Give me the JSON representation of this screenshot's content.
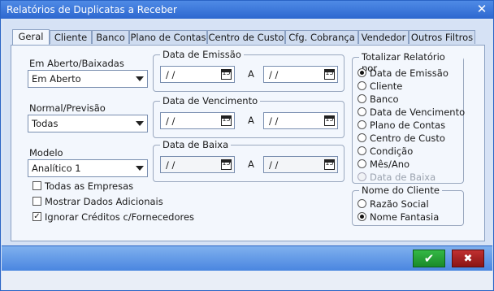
{
  "window": {
    "title": "Relatórios de Duplicatas a Receber",
    "close_glyph": "✕"
  },
  "tabs": [
    {
      "label": "Geral"
    },
    {
      "label": "Cliente"
    },
    {
      "label": "Banco"
    },
    {
      "label": "Plano de Contas"
    },
    {
      "label": "Centro de Custo"
    },
    {
      "label": "Cfg. Cobrança"
    },
    {
      "label": "Vendedor"
    },
    {
      "label": "Outros Filtros"
    }
  ],
  "filters": {
    "aberto_label": "Em Aberto/Baixadas",
    "aberto_value": "Em Aberto",
    "normal_label": "Normal/Previsão",
    "normal_value": "Todas",
    "modelo_label": "Modelo",
    "modelo_value": "Analítico 1"
  },
  "dates": {
    "emissao_title": "Data de Emissão",
    "vencimento_title": "Data de Vencimento",
    "baixa_title": "Data de Baixa",
    "placeholder": " / /",
    "a_label": "A",
    "cal_glyph": "15"
  },
  "options": {
    "todas_empresas": "Todas as Empresas",
    "mostrar_adicionais": "Mostrar Dados Adicionais",
    "ignorar_creditos": "Ignorar Créditos c/Fornecedores",
    "check_glyph": "✓"
  },
  "totalizar": {
    "title": "Totalizar Relatório por",
    "items": [
      "Data de Emissão",
      "Cliente",
      "Banco",
      "Data de Vencimento",
      "Plano de Contas",
      "Centro de Custo",
      "Condição",
      "Mês/Ano",
      "Data de Baixa"
    ]
  },
  "nome_cliente": {
    "title": "Nome do Cliente",
    "items": [
      "Razão Social",
      "Nome Fantasia"
    ]
  },
  "buttons": {
    "ok_glyph": "✔",
    "cancel_glyph": "✖"
  }
}
